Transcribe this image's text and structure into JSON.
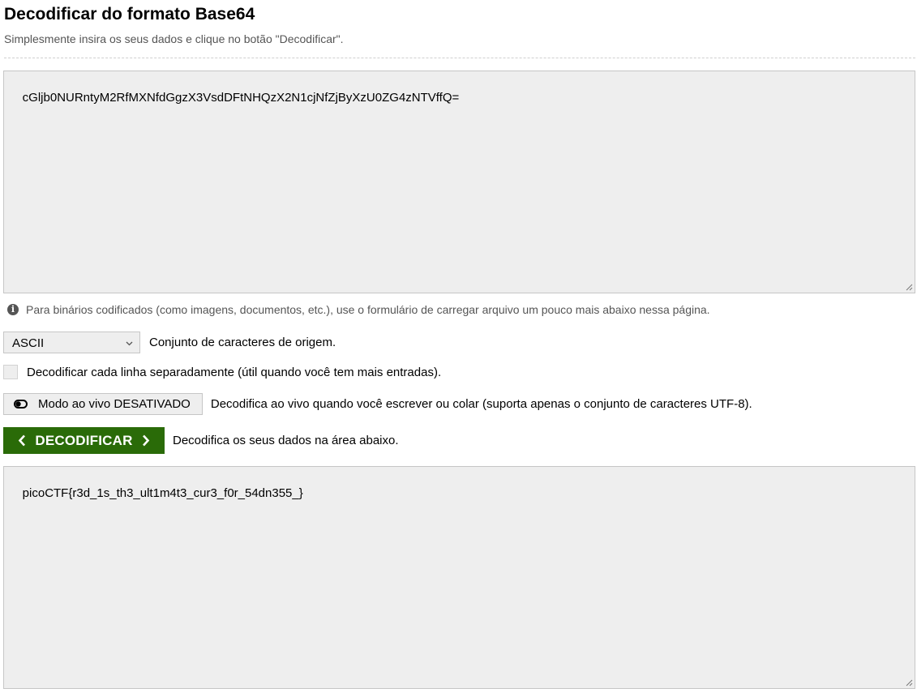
{
  "header": {
    "title": "Decodificar do formato Base64",
    "subtitle": "Simplesmente insira os seus dados e clique no botão \"Decodificar\"."
  },
  "input": {
    "value": "cGljb0NURntyM2RfMXNfdGgzX3VsdDFtNHQzX2N1cjNfZjByXzU0ZG4zNTVffQ="
  },
  "info": {
    "text": "Para binários codificados (como imagens, documentos, etc.), use o formulário de carregar arquivo um pouco mais abaixo nessa página."
  },
  "charset": {
    "selected": "ASCII",
    "label": "Conjunto de caracteres de origem."
  },
  "line_by_line": {
    "checked": false,
    "label": "Decodificar cada linha separadamente (útil quando você tem mais entradas)."
  },
  "live_mode": {
    "button_label": "Modo ao vivo DESATIVADO",
    "description": "Decodifica ao vivo quando você escrever ou colar (suporta apenas o conjunto de caracteres UTF-8)."
  },
  "decode": {
    "button_label": "DECODIFICAR",
    "description": "Decodifica os seus dados na área abaixo."
  },
  "output": {
    "value": "picoCTF{r3d_1s_th3_ult1m4t3_cur3_f0r_54dn355_}"
  },
  "colors": {
    "decode_button": "#2a6b08",
    "textarea_bg": "#eeeeee",
    "muted_text": "#555555"
  }
}
